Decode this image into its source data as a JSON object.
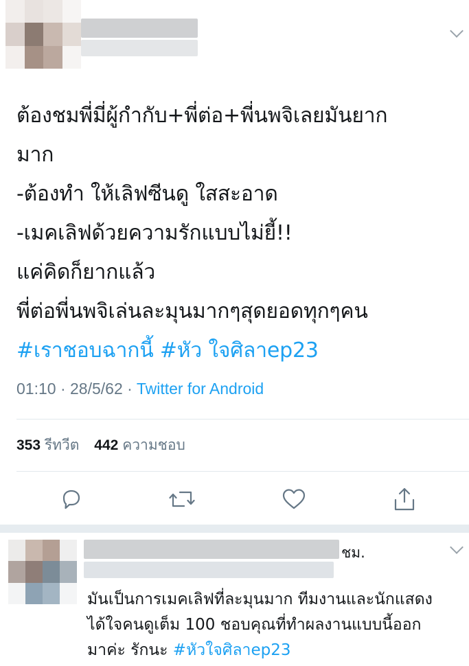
{
  "colors": {
    "text": "#14171a",
    "secondary": "#657786",
    "link": "#1da1f2",
    "divider": "#e1e8ed",
    "icon": "#657786"
  },
  "tweet": {
    "lines": [
      "ต้องชมพี่มี่ผู้กำกับ+พี่ต่อ+พี่นพจิเลยมันยาก",
      "มาก",
      "-ต้องทำ ให้เลิฟซีนดู ใสสะอาด",
      "-เมคเลิฟด้วยความรักแบบไม่ยี้!!",
      "แค่คิดก็ยากแล้ว",
      "พี่ต่อพี่นพจิเล่นละมุนมากๆสุดยอดทุกๆคน"
    ],
    "hashtag1": "#เราชอบฉากนี้",
    "hashtag2": "#หัว ใจศิลาep23",
    "time": "01:10",
    "date": "28/5/62",
    "separator": "·",
    "source": "Twitter for Android"
  },
  "stats": {
    "retweets": "353",
    "retweets_label": "รีทวีต",
    "likes": "442",
    "likes_label": "ความชอบ"
  },
  "actions": [
    "reply-icon",
    "retweet-icon",
    "like-icon",
    "share-icon"
  ],
  "reply": {
    "name_tail": "ชม.",
    "lines": [
      "มันเป็นการเมคเลิฟที่ละมุนมาก ทีมงานและนักแสดง",
      "ได้ใจคนดูเต็ม 100 ชอบคุณที่ทำผลงานแบบนี้ออก"
    ],
    "line3_text": "มาค่ะ รักนะ ",
    "line3_hashtag": "#หัวใจศิลาep23"
  }
}
